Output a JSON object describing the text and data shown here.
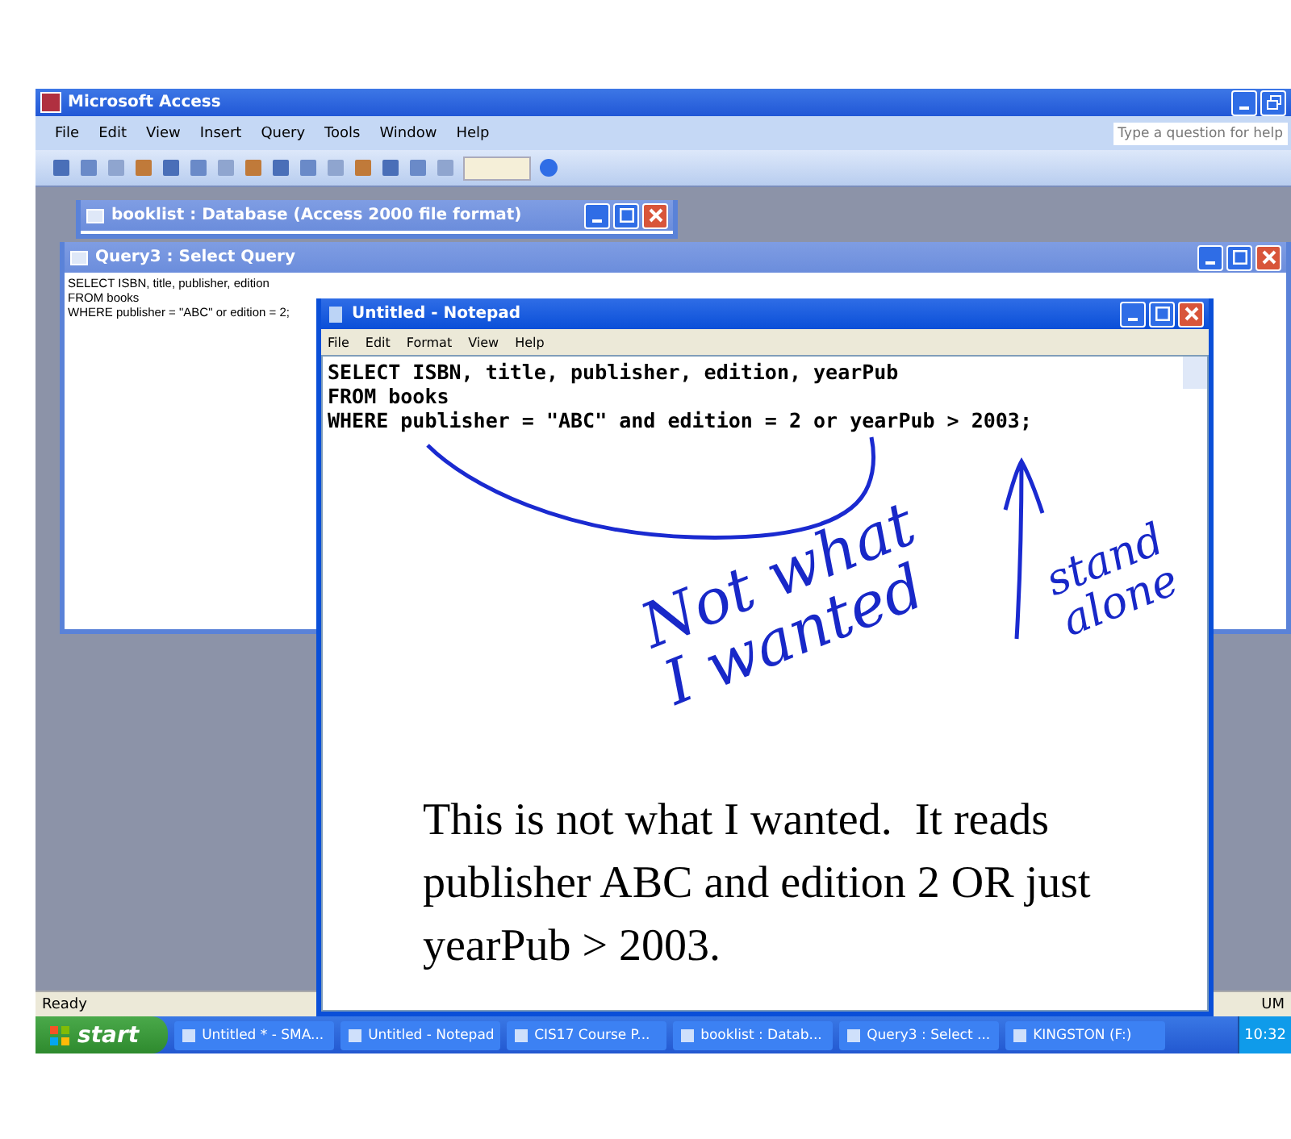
{
  "access": {
    "title": "Microsoft Access",
    "menu": [
      "File",
      "Edit",
      "View",
      "Insert",
      "Query",
      "Tools",
      "Window",
      "Help"
    ],
    "help_placeholder": "Type a question for help",
    "status_left": "Ready",
    "status_right": "UM"
  },
  "mdi_windows": [
    {
      "title": "booklist : Database (Access 2000 file format)"
    },
    {
      "title": "Query3 : Select Query",
      "lines": [
        "SELECT ISBN, title, publisher, edition",
        "FROM books",
        "WHERE publisher = \"ABC\" or edition = 2;"
      ]
    }
  ],
  "notepad": {
    "title": "Untitled - Notepad",
    "menu": [
      "File",
      "Edit",
      "Format",
      "View",
      "Help"
    ],
    "lines": [
      "SELECT ISBN, title, publisher, edition, yearPub",
      "FROM books",
      "WHERE publisher = \"ABC\" and edition = 2 or yearPub > 2003;"
    ]
  },
  "annotations": [
    {
      "lines": [
        "Not what",
        "I wanted"
      ]
    },
    {
      "lines": [
        "stand",
        "alone"
      ]
    }
  ],
  "caption": "This is not what I wanted.  It reads publisher ABC and edition 2 OR just yearPub > 2003.",
  "taskbar": {
    "start": "start",
    "tasks": [
      "Untitled * - SMA...",
      "Untitled - Notepad",
      "CIS17 Course P...",
      "booklist : Datab...",
      "Query3 : Select ...",
      "KINGSTON (F:)"
    ],
    "clock": "10:32"
  }
}
